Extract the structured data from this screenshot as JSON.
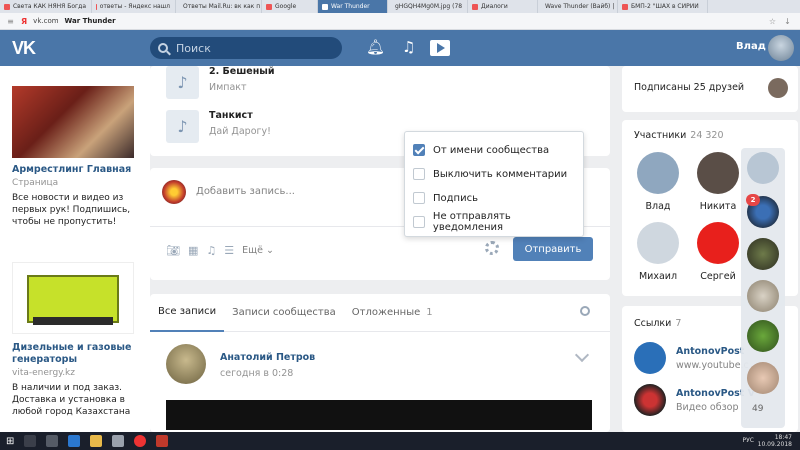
{
  "browser": {
    "tabs": [
      {
        "label": "Света КАК НЯНЯ Богда",
        "active": false
      },
      {
        "label": "ответы - Яндекс нашл",
        "active": false
      },
      {
        "label": "Ответы Mail.Ru: вк как п",
        "active": false
      },
      {
        "label": "Google",
        "active": false
      },
      {
        "label": "War Thunder",
        "active": true
      },
      {
        "label": "gHGQH4Mg0M.jpg (78",
        "active": false
      },
      {
        "label": "Диалоги",
        "active": false
      },
      {
        "label": "Wave Thunder (Вайб) |",
        "active": false
      },
      {
        "label": "БМП-2 \"ШАХ в СИРИИ",
        "active": false
      }
    ],
    "url": "vk.com",
    "page_title": "War Thunder"
  },
  "header": {
    "logo": "VK",
    "search_placeholder": "Поиск",
    "user_name": "Влад"
  },
  "ads": [
    {
      "title": "Армрестлинг Главная",
      "subtitle": "Страница",
      "description": "Все новости и видео из первых рук! Подпишись, чтобы не пропустить!"
    },
    {
      "title": "Дизельные и газовые генераторы",
      "subtitle": "vita-energy.kz",
      "description": "В наличии и под заказ. Доставка и установка в любой город Казахстана"
    }
  ],
  "tracks": [
    {
      "title": "2. Бешеный",
      "artist": "Импакт"
    },
    {
      "title": "Танкист",
      "artist": "Дай Дарогу!"
    }
  ],
  "composer": {
    "placeholder": "Добавить запись...",
    "more_label": "Ещё",
    "send_label": "Отправить"
  },
  "post_options": [
    {
      "label": "От имени сообщества",
      "checked": true
    },
    {
      "label": "Выключить комментарии",
      "checked": false
    },
    {
      "label": "Подпись",
      "checked": false
    },
    {
      "label": "Не отправлять уведомления",
      "checked": false
    }
  ],
  "wall_tabs": [
    {
      "label": "Все записи",
      "active": true,
      "count": ""
    },
    {
      "label": "Записи сообщества",
      "active": false,
      "count": ""
    },
    {
      "label": "Отложенные",
      "active": false,
      "count": "1"
    }
  ],
  "post": {
    "author": "Анатолий Петров",
    "time": "сегодня в 0:28"
  },
  "friends": {
    "label": "Подписаны 25 друзей"
  },
  "members": {
    "title": "Участники",
    "count": "24 320",
    "list": [
      {
        "name": "Влад",
        "color": "#8fa7bf"
      },
      {
        "name": "Никита",
        "color": "#5a4e47"
      },
      {
        "name": "Михаил",
        "color": "#cfd7df"
      },
      {
        "name": "Сергей",
        "color": "#e8201c"
      }
    ]
  },
  "links": {
    "title": "Ссылки",
    "count": "7",
    "list": [
      {
        "name": "AntonovPost",
        "desc": "www.youtube.c"
      },
      {
        "name": "AntonovPost V",
        "desc": "Видео обзор"
      }
    ]
  },
  "chat": {
    "badge": "2",
    "count": "49"
  },
  "taskbar": {
    "time": "18:47",
    "date": "10.09.2018",
    "lang": "РУС"
  }
}
